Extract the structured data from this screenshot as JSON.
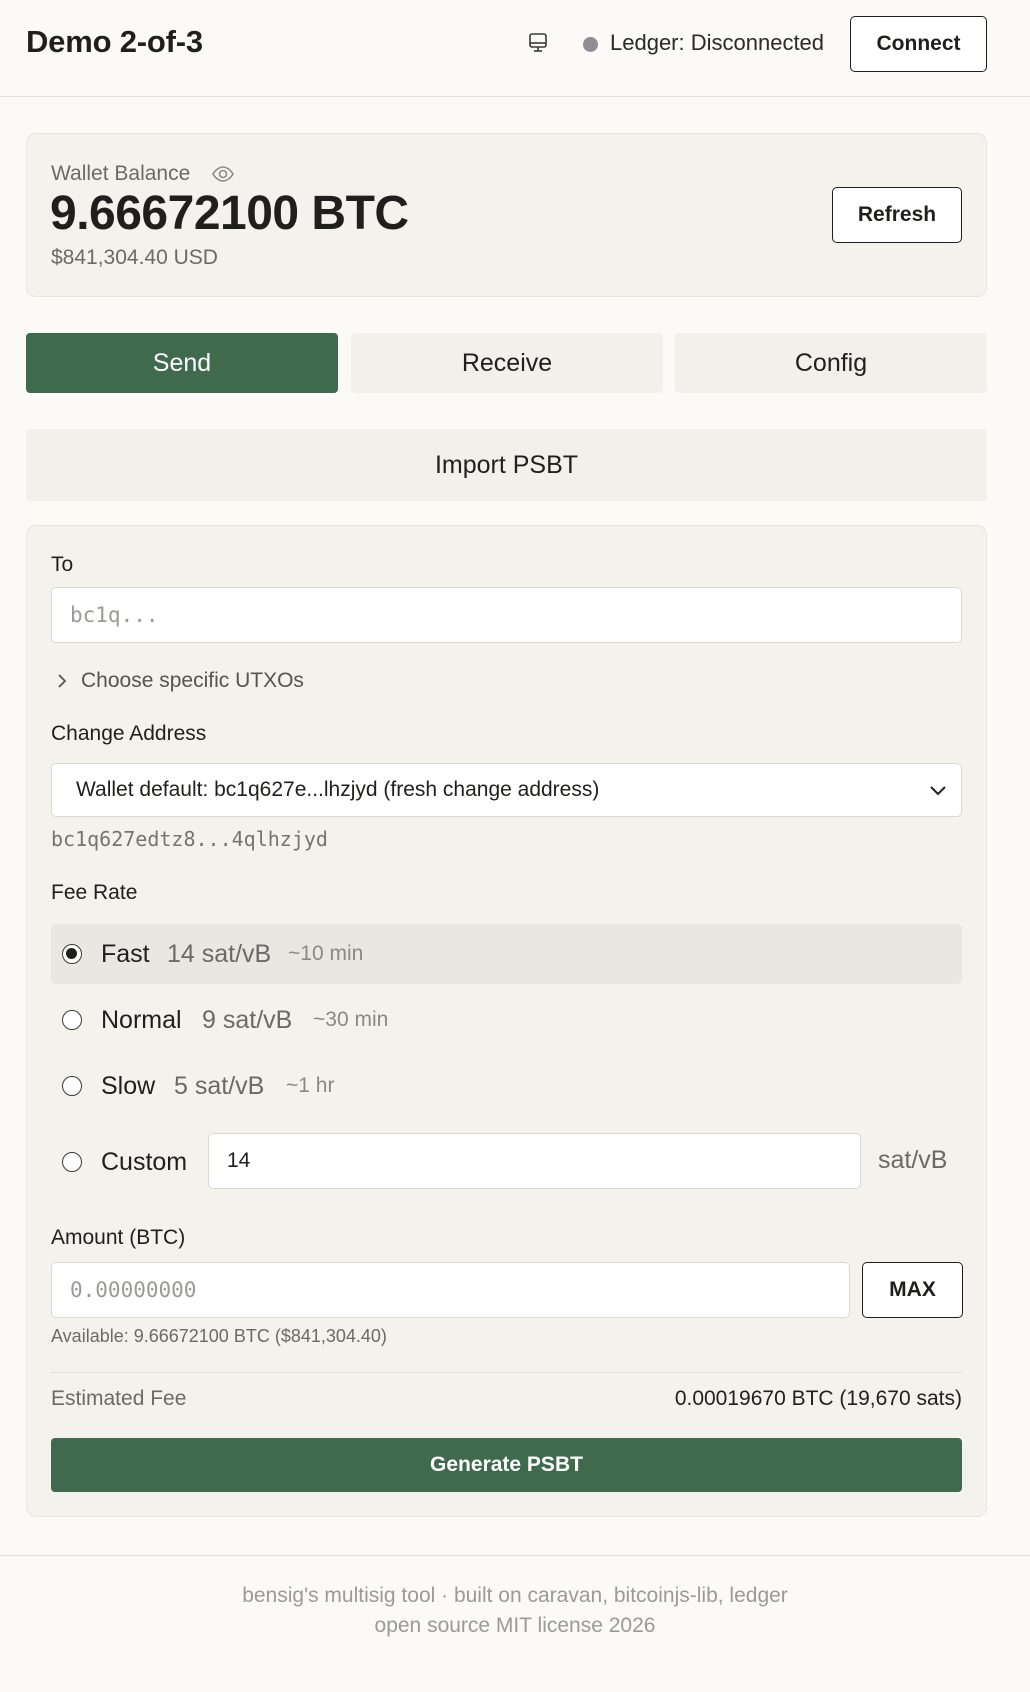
{
  "header": {
    "title": "Demo 2-of-3",
    "device_status": "Ledger: Disconnected",
    "status_color": "#8e8d93",
    "connect_label": "Connect"
  },
  "balance": {
    "label": "Wallet Balance",
    "btc": "9.66672100 BTC",
    "usd": "$841,304.40 USD",
    "refresh_label": "Refresh"
  },
  "tabs": [
    {
      "label": "Send",
      "active": true
    },
    {
      "label": "Receive",
      "active": false
    },
    {
      "label": "Config",
      "active": false
    }
  ],
  "import_label": "Import PSBT",
  "form": {
    "to_label": "To",
    "to_placeholder": "bc1q...",
    "to_value": "",
    "utxo_toggle": "Choose specific UTXOs",
    "change_label": "Change Address",
    "change_selected": "Wallet default: bc1q627e...lhzjyd (fresh change address)",
    "change_hash": "bc1q627edtz8...4qlhzjyd",
    "fee_label": "Fee Rate",
    "fee_options": [
      {
        "name": "Fast",
        "rate": "14 sat/vB",
        "time": "~10 min",
        "selected": true
      },
      {
        "name": "Normal",
        "rate": "9 sat/vB",
        "time": "~30 min",
        "selected": false
      },
      {
        "name": "Slow",
        "rate": "5 sat/vB",
        "time": "~1 hr",
        "selected": false
      }
    ],
    "custom_label": "Custom",
    "custom_value": "14",
    "custom_unit": "sat/vB",
    "amount_label": "Amount (BTC)",
    "amount_placeholder": "0.00000000",
    "max_label": "MAX",
    "available": "Available: 9.66672100 BTC ($841,304.40)",
    "est_fee_label": "Estimated Fee",
    "est_fee_value": "0.00019670 BTC (19,670 sats)",
    "generate_label": "Generate PSBT"
  },
  "footer": {
    "line1": "bensig's multisig tool · built on caravan, bitcoinjs-lib, ledger",
    "line2": "open source MIT license 2026"
  },
  "colors": {
    "accent": "#3f6a4e",
    "background": "#fbfaf6",
    "card": "#f4f2ec"
  }
}
